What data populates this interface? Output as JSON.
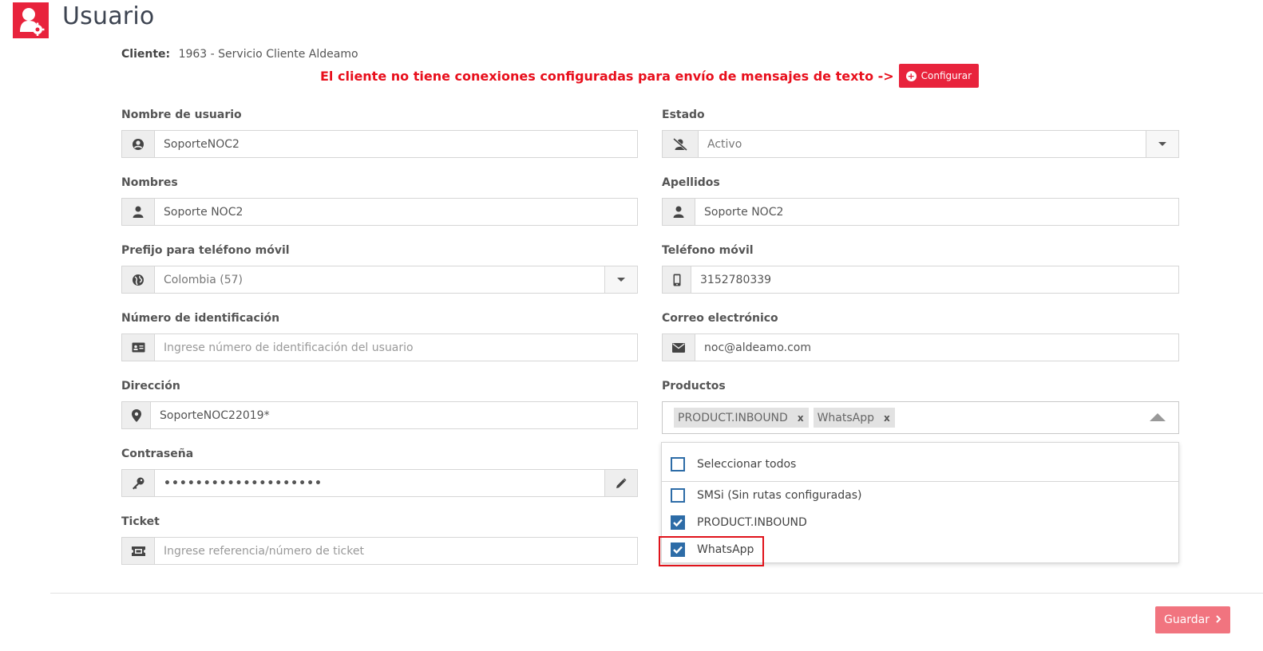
{
  "header": {
    "title": "Usuario",
    "icon": "user-gear-icon",
    "accent": "#e8233c"
  },
  "client": {
    "label": "Cliente:",
    "value": "1963 - Servicio Cliente Aldeamo"
  },
  "warning": {
    "text": "El cliente no tiene conexiones configuradas para envío de mensajes de texto ->",
    "button_label": "Configurar",
    "color": "#e80f1c"
  },
  "form": {
    "username": {
      "label": "Nombre de usuario",
      "value": "SoporteNOC2"
    },
    "status": {
      "label": "Estado",
      "value": "Activo"
    },
    "first_names": {
      "label": "Nombres",
      "value": "Soporte NOC2"
    },
    "last_names": {
      "label": "Apellidos",
      "value": "Soporte NOC2"
    },
    "phone_prefix": {
      "label": "Prefijo para teléfono móvil",
      "value": "Colombia (57)"
    },
    "mobile": {
      "label": "Teléfono móvil",
      "value": "3152780339"
    },
    "id_number": {
      "label": "Número de identificación",
      "placeholder": "Ingrese número de identificación del usuario"
    },
    "email": {
      "label": "Correo electrónico",
      "value": "noc@aldeamo.com"
    },
    "address": {
      "label": "Dirección",
      "value": "SoporteNOC22019*"
    },
    "products": {
      "label": "Productos",
      "tags": [
        "PRODUCT.INBOUND",
        "WhatsApp"
      ],
      "tag_remove": "x"
    },
    "password": {
      "label": "Contraseña",
      "value": "••••••••••••••••••••"
    },
    "ticket": {
      "label": "Ticket",
      "placeholder": "Ingrese referencia/número de ticket"
    }
  },
  "products_dropdown": {
    "select_all": {
      "label": "Seleccionar todos",
      "checked": false
    },
    "options": [
      {
        "label": "SMSi (Sin rutas configuradas)",
        "checked": false
      },
      {
        "label": "PRODUCT.INBOUND",
        "checked": true
      },
      {
        "label": "WhatsApp",
        "checked": true
      }
    ],
    "check_color": "#2d6ca7"
  },
  "footer": {
    "save_label": "Guardar",
    "save_color": "#f1747f"
  }
}
